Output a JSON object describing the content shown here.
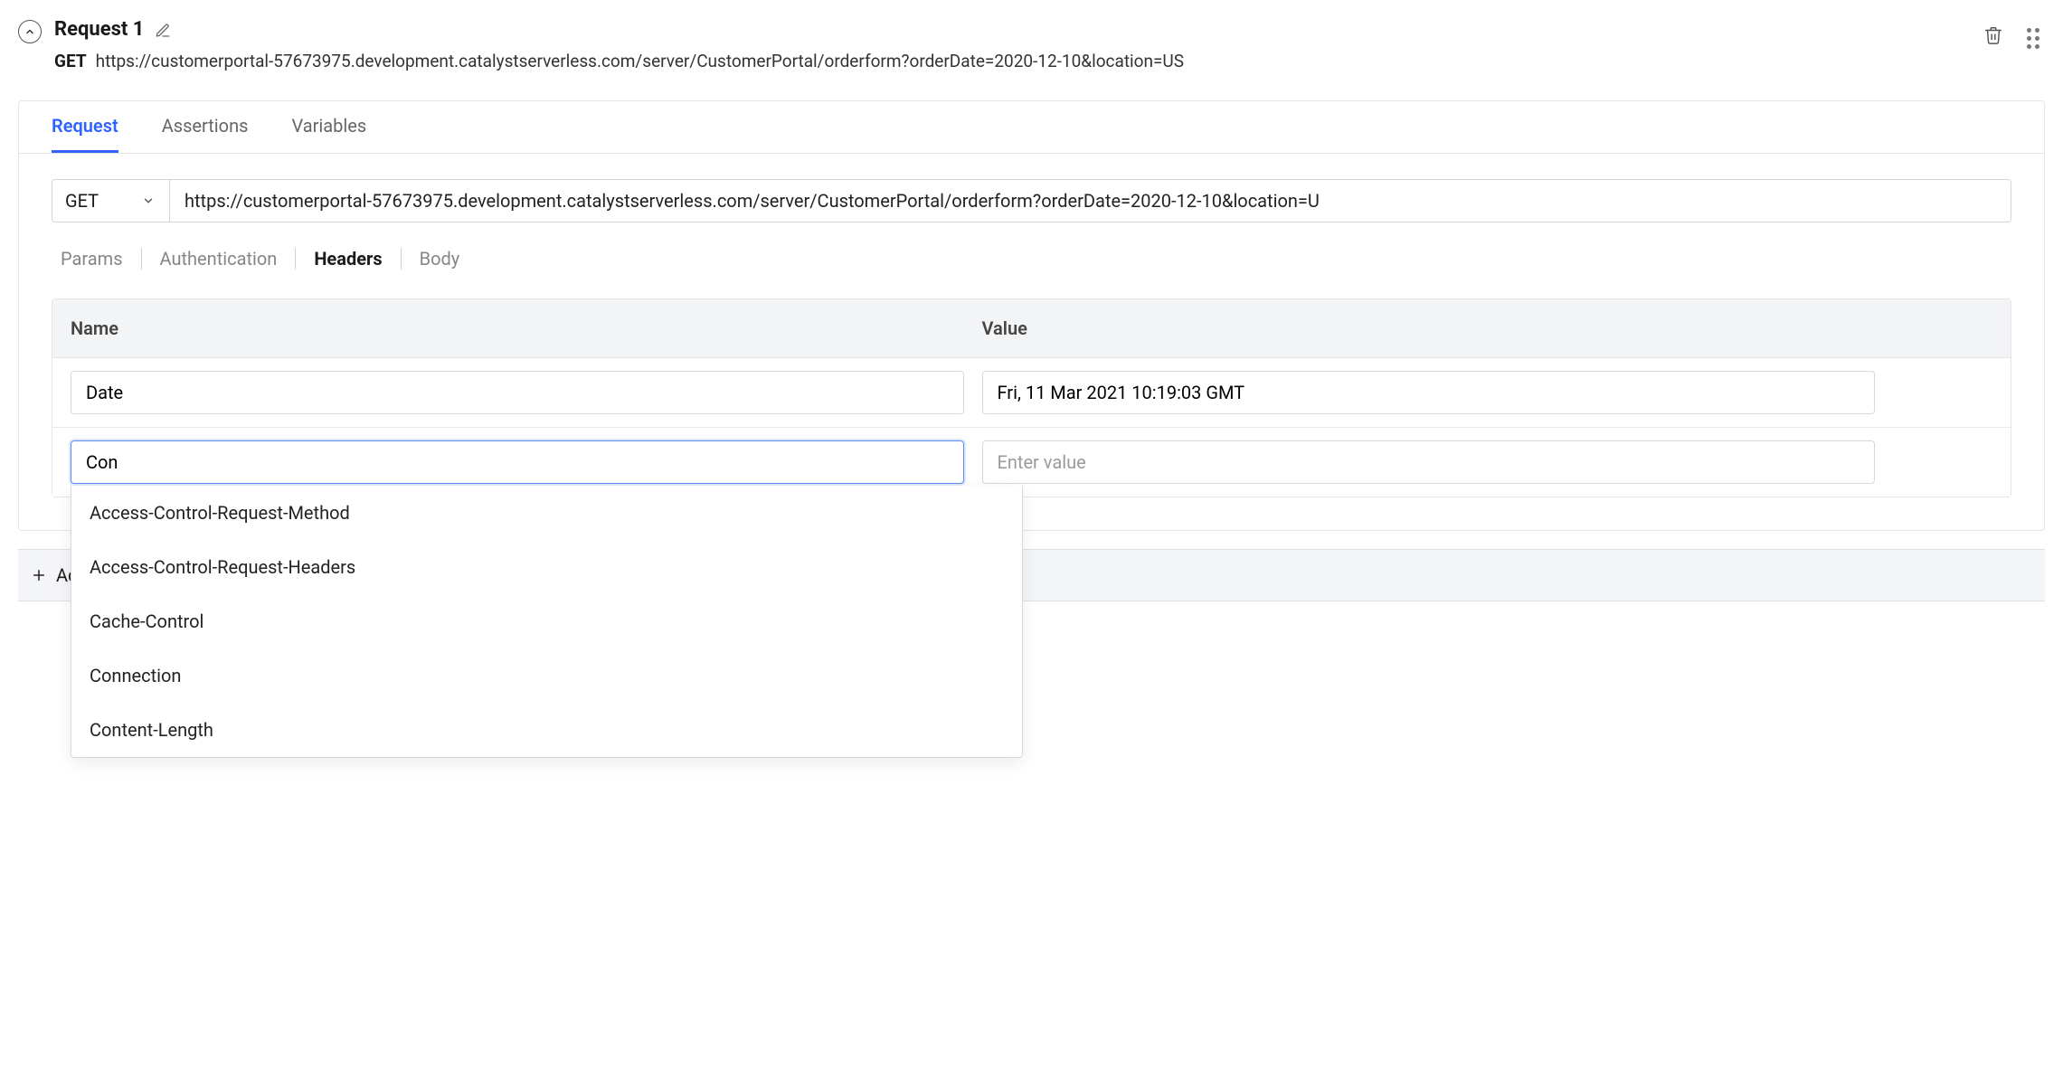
{
  "header": {
    "title": "Request 1",
    "method": "GET",
    "url": "https://customerportal-57673975.development.catalystserverless.com/server/CustomerPortal/orderform?orderDate=2020-12-10&location=US"
  },
  "main_tabs": {
    "request": "Request",
    "assertions": "Assertions",
    "variables": "Variables"
  },
  "url_bar": {
    "method": "GET",
    "url": "https://customerportal-57673975.development.catalystserverless.com/server/CustomerPortal/orderform?orderDate=2020-12-10&location=U"
  },
  "sub_tabs": {
    "params": "Params",
    "authentication": "Authentication",
    "headers": "Headers",
    "body": "Body"
  },
  "table": {
    "name_label": "Name",
    "value_label": "Value",
    "rows": [
      {
        "name": "Date",
        "value": "Fri, 11 Mar 2021 10:19:03 GMT"
      }
    ],
    "editing": {
      "name": "Con",
      "value_placeholder": "Enter value"
    },
    "autocomplete": [
      "Access-Control-Request-Method",
      "Access-Control-Request-Headers",
      "Cache-Control",
      "Connection",
      "Content-Length"
    ]
  },
  "footer": {
    "add_label": "Add"
  },
  "colors": {
    "accent": "#2f63ff"
  }
}
